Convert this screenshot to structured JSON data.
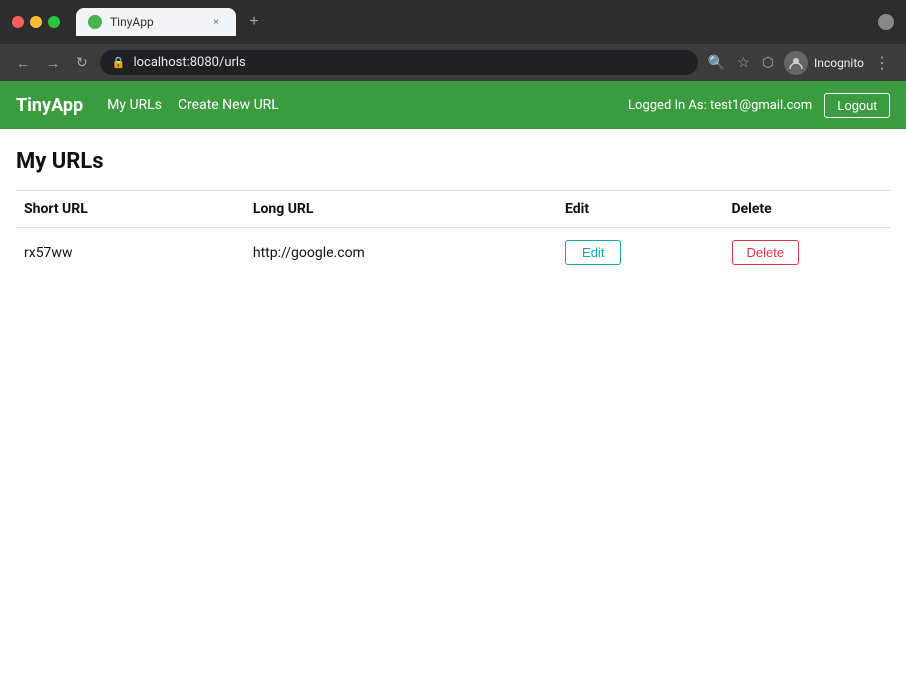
{
  "browser": {
    "tab_title": "TinyApp",
    "tab_close_icon": "×",
    "tab_new_icon": "+",
    "address": "localhost:8080/urls",
    "extension_icon": "⬡",
    "nav_back": "←",
    "nav_forward": "→",
    "nav_reload": "↻",
    "search_icon": "🔍",
    "bookmark_icon": "☆",
    "extensions_icon": "⬡",
    "incognito_label": "Incognito",
    "menu_icon": "⋮"
  },
  "navbar": {
    "brand": "TinyApp",
    "links": [
      {
        "label": "My URLs",
        "href": "#"
      },
      {
        "label": "Create New URL",
        "href": "#"
      }
    ],
    "logged_in_label": "Logged In As: test1@gmail.com",
    "logout_label": "Logout"
  },
  "main": {
    "page_title": "My URLs",
    "table": {
      "headers": [
        "Short URL",
        "Long URL",
        "Edit",
        "Delete"
      ],
      "rows": [
        {
          "short_url": "rx57ww",
          "long_url": "http://google.com",
          "edit_label": "Edit",
          "delete_label": "Delete"
        }
      ]
    }
  }
}
